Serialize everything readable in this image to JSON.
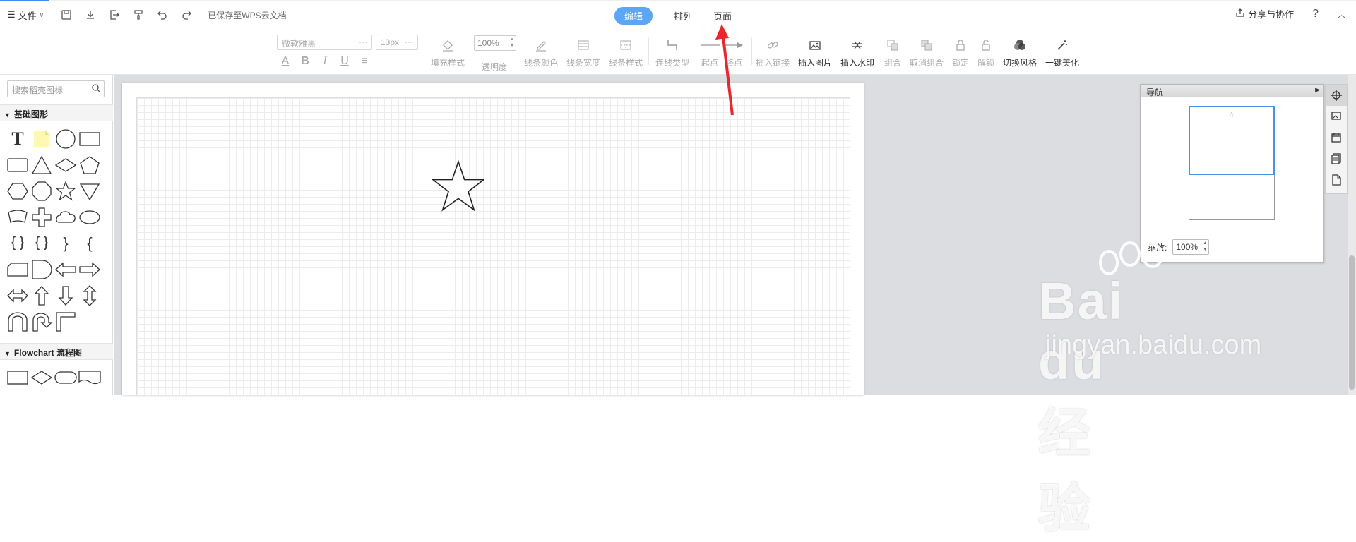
{
  "topbar": {
    "file_label": "文件",
    "saved_status": "已保存至WPS云文档",
    "tabs": [
      {
        "label": "编辑",
        "active": true
      },
      {
        "label": "排列",
        "active": false
      },
      {
        "label": "页面",
        "active": false
      }
    ],
    "share_label": "分享与协作",
    "help_label": "?"
  },
  "ribbon": {
    "font_placeholder": "微软雅黑",
    "font_size_placeholder": "13px",
    "opacity_value": "100%",
    "buttons": {
      "fill_style": "填充样式",
      "opacity": "透明度",
      "line_color": "线条颜色",
      "line_width": "线条宽度",
      "line_style": "线条样式",
      "connector_type": "连线类型",
      "start_point": "起点",
      "end_point": "终点",
      "insert_link": "插入链接",
      "insert_image": "插入图片",
      "insert_watermark": "插入水印",
      "group": "组合",
      "ungroup": "取消组合",
      "lock": "锁定",
      "unlock": "解锁",
      "switch_style": "切换风格",
      "beautify": "一键美化"
    }
  },
  "left_panel": {
    "search_placeholder": "搜索稻壳图标",
    "categories": [
      {
        "label": "基础图形"
      },
      {
        "label": "Flowchart 流程图"
      }
    ]
  },
  "nav_panel": {
    "title": "导航",
    "zoom_label": "缩放:",
    "zoom_value": "100%"
  },
  "watermark": {
    "brand": "Bai du 经验",
    "url": "jingyan.baidu.com"
  },
  "colors": {
    "accent": "#5ba7f5",
    "arrow": "#e8262b",
    "canvas_bg": "#dcdde0"
  }
}
